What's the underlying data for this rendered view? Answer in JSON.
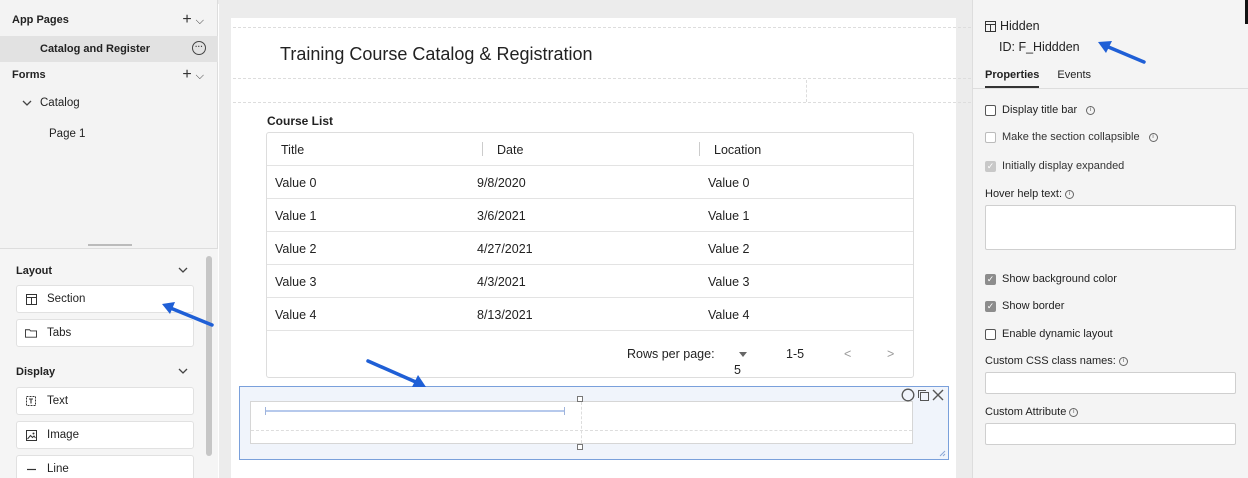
{
  "left_panel": {
    "app_pages_label": "App Pages",
    "add_glyph": "+",
    "chevron_glyph": "⌵",
    "current_page": "Catalog and Register",
    "forms_label": "Forms",
    "tree": {
      "catalog": "Catalog",
      "page1": "Page 1"
    },
    "layout_label": "Layout",
    "layout_items": [
      "Section",
      "Tabs"
    ],
    "display_label": "Display",
    "display_items": [
      "Text",
      "Image",
      "Line"
    ]
  },
  "canvas": {
    "page_title": "Training Course Catalog & Registration",
    "course_list_label": "Course List",
    "table": {
      "columns": [
        "Title",
        "Date",
        "Location"
      ],
      "rows": [
        [
          "Value 0",
          "9/8/2020",
          "Value 0"
        ],
        [
          "Value 1",
          "3/6/2021",
          "Value 1"
        ],
        [
          "Value 2",
          "4/27/2021",
          "Value 2"
        ],
        [
          "Value 3",
          "4/3/2021",
          "Value 3"
        ],
        [
          "Value 4",
          "8/13/2021",
          "Value 4"
        ]
      ],
      "rows_per_page_label": "Rows per page:",
      "rows_per_page_value": "5",
      "range_text": "1-5",
      "prev_glyph": "<",
      "next_glyph": ">"
    }
  },
  "right_panel": {
    "component_name": "Hidden",
    "component_id": "ID: F_Hiddden",
    "tabs": [
      "Properties",
      "Events"
    ],
    "checkboxes": {
      "display_title_bar": "Display title bar",
      "collapsible": "Make the section collapsible",
      "initially_expanded": "Initially display expanded",
      "show_background": "Show background color",
      "show_border": "Show border",
      "dynamic_layout": "Enable dynamic layout"
    },
    "hover_help_label": "Hover help text:",
    "css_class_label": "Custom CSS class names:",
    "custom_attr_label": "Custom Attribute",
    "info_glyph": "i"
  },
  "colors": {
    "annotation_arrow": "#1f5fd6",
    "selection_border": "#7aa0db",
    "checkbox_checked": "#8c8c8c"
  }
}
